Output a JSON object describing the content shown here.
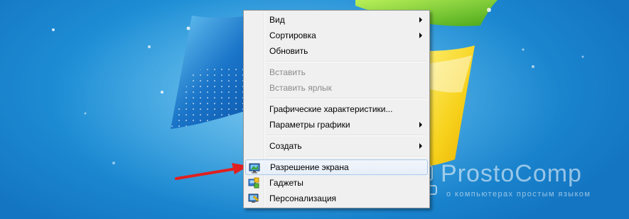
{
  "menu": {
    "items": [
      {
        "label": "Вид",
        "submenu": true,
        "enabled": true
      },
      {
        "label": "Сортировка",
        "submenu": true,
        "enabled": true
      },
      {
        "label": "Обновить",
        "submenu": false,
        "enabled": true
      },
      {
        "label": "Вставить",
        "submenu": false,
        "enabled": false
      },
      {
        "label": "Вставить ярлык",
        "submenu": false,
        "enabled": false
      },
      {
        "label": "Графические характеристики...",
        "submenu": false,
        "enabled": true
      },
      {
        "label": "Параметры графики",
        "submenu": true,
        "enabled": true
      },
      {
        "label": "Создать",
        "submenu": true,
        "enabled": true
      },
      {
        "label": "Разрешение экрана",
        "submenu": false,
        "enabled": true,
        "highlighted": true,
        "icon": "display-icon"
      },
      {
        "label": "Гаджеты",
        "submenu": false,
        "enabled": true,
        "icon": "gadgets-icon"
      },
      {
        "label": "Персонализация",
        "submenu": false,
        "enabled": true,
        "icon": "personalization-icon"
      }
    ]
  },
  "watermark": {
    "title": "ProstoComp",
    "subtitle": "о компьютерах простым языком",
    "icon": "computer-logo-icon"
  },
  "colors": {
    "desktop": "#1e8fd6",
    "menu_bg": "#f0f0f0",
    "highlight_border": "#a8c8ea",
    "arrow": "#e02020"
  }
}
